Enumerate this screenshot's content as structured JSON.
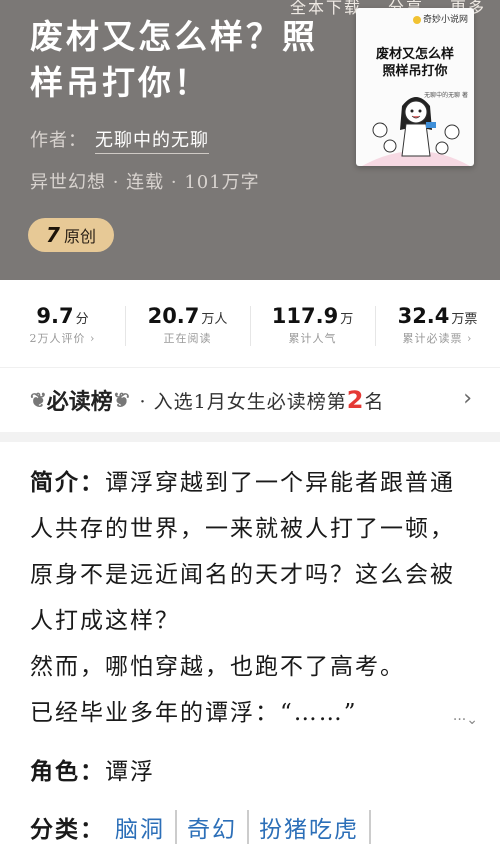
{
  "header": {
    "actions": [
      "全本下载",
      "分享",
      "更多"
    ],
    "title": "废材又怎么样？照样吊打你！",
    "author_label": "作者：",
    "author_name": "无聊中的无聊",
    "meta": "异世幻想 · 连载 · 101万字",
    "badge": "原创",
    "badge_icon": "7"
  },
  "cover": {
    "brand": "奇妙小说网",
    "title_line1": "废材又怎么样",
    "title_line2": "照样吊打你",
    "author": "无聊中的无聊 著"
  },
  "stats": [
    {
      "value": "9.7",
      "unit": "分",
      "label": "2万人评价 ›"
    },
    {
      "value": "20.7",
      "unit": "万人",
      "label": "正在阅读"
    },
    {
      "value": "117.9",
      "unit": "万",
      "label": "累计人气"
    },
    {
      "value": "32.4",
      "unit": "万票",
      "label": "累计必读票 ›"
    }
  ],
  "ranking": {
    "title": "必读榜",
    "text_prefix": "· 入选1月女生必读榜第",
    "rank": "2",
    "text_suffix": "名",
    "arrow": "›"
  },
  "intro": {
    "label": "简介：",
    "p1": "谭浮穿越到了一个异能者跟普通人共存的世界，一来就被人打了一顿，原身不是远近闻名的天才吗？这么会被人打成这样？",
    "p2": "然而，哪怕穿越，也跑不了高考。",
    "p3": "已经毕业多年的谭浮：“……”",
    "expand": "···⌄"
  },
  "role": {
    "label": "角色：",
    "value": "谭浮"
  },
  "category": {
    "label": "分类：",
    "tags": [
      "脑洞",
      "奇幻",
      "扮猪吃虎"
    ]
  }
}
